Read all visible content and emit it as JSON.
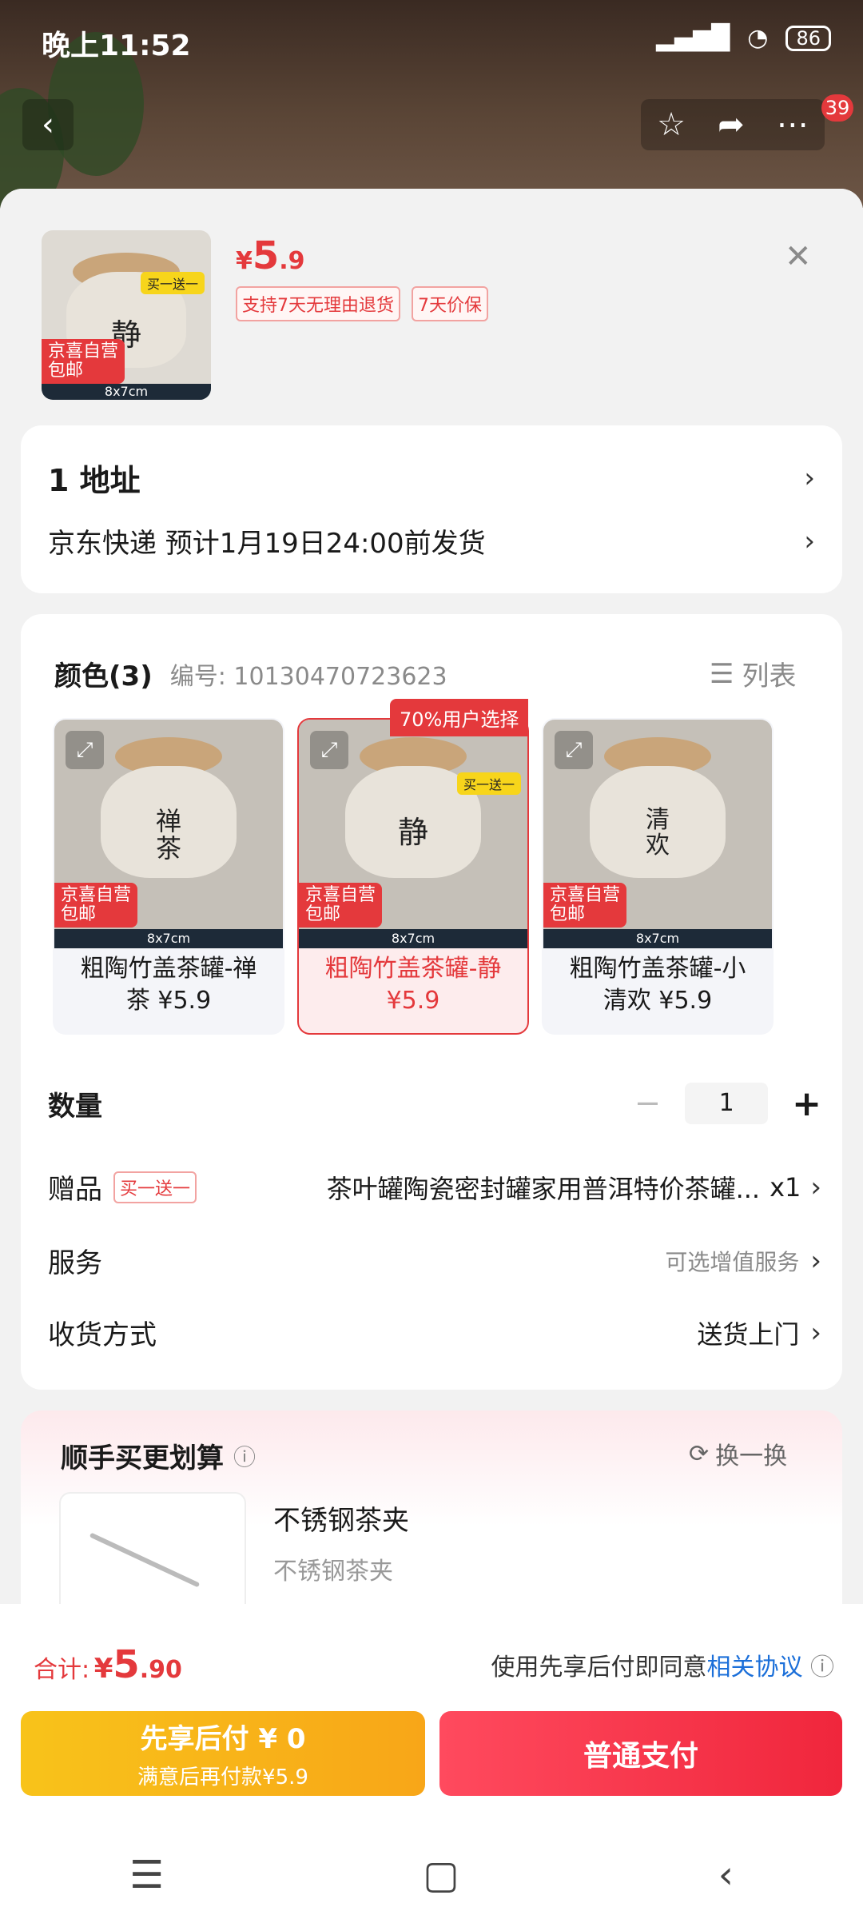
{
  "status": {
    "time": "晚上11:52",
    "battery": "86"
  },
  "topbar": {
    "badge": "39"
  },
  "sku": {
    "thumb_badge": "买一送一",
    "thumb_jd": "京喜自营",
    "thumb_free": "包邮",
    "thumb_dim": "8x7cm",
    "price_symbol": "¥",
    "price_int": "5",
    "price_dec": ".9",
    "tags": [
      "支持7天无理由退货",
      "7天价保"
    ]
  },
  "address": {
    "title": "1 地址",
    "delivery": "京东快递 预计1月19日24:00前发货"
  },
  "color": {
    "title": "颜色(3)",
    "code": "编号: 10130470723623",
    "list_label": "列表",
    "popular_badge": "70%用户选择",
    "options": [
      {
        "line1": "粗陶竹盖茶罐-禅",
        "line2": "茶 ¥5.9",
        "char": "禅茶",
        "selected": false
      },
      {
        "line1": "粗陶竹盖茶罐-静",
        "line2": "¥5.9",
        "char": "静",
        "selected": true
      },
      {
        "line1": "粗陶竹盖茶罐-小",
        "line2": "清欢 ¥5.9",
        "char": "清欢",
        "selected": false
      }
    ],
    "jd": "京喜自营",
    "free": "包邮",
    "dim": "8x7cm",
    "bogo": "买一送一"
  },
  "quantity": {
    "label": "数量",
    "value": "1",
    "minus": "−",
    "plus": "+"
  },
  "gift": {
    "label": "赠品",
    "tag": "买一送一",
    "text": "茶叶罐陶瓷密封罐家用普洱特价茶罐...",
    "count": "x1"
  },
  "service": {
    "label": "服务",
    "value": "可选增值服务"
  },
  "shipping": {
    "label": "收货方式",
    "value": "送货上门"
  },
  "upsell": {
    "title": "顺手买更划算",
    "refresh": "换一换",
    "item_title": "不锈钢茶夹",
    "item_sub": "不锈钢茶夹"
  },
  "footer": {
    "total_label": "合计:",
    "total_symbol": "¥",
    "total_int": "5",
    "total_dec": ".90",
    "agree_text": "使用先享后付即同意",
    "agree_link": "相关协议",
    "btn_left_title": "先享后付 ¥ 0",
    "btn_left_sub": "满意后再付款¥5.9",
    "btn_right": "普通支付"
  },
  "colors": {
    "accent": "#e4393c",
    "link": "#1b6fd9",
    "gold": "#f8b418"
  }
}
